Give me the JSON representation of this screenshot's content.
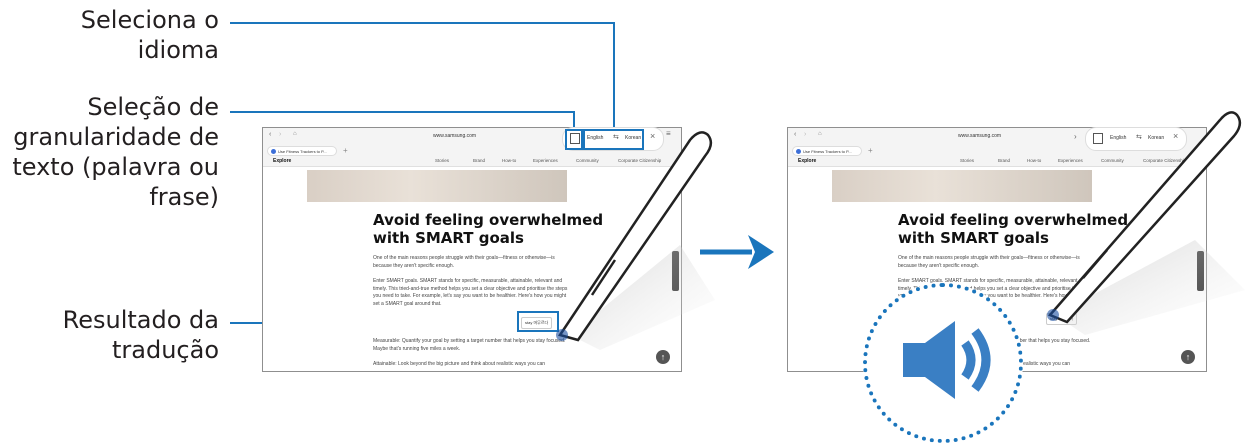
{
  "callouts": {
    "language": "Seleciona o\nidioma",
    "granularity": "Seleção de\ngranularidade de\ntexto (palavra ou\nfrase)",
    "result": "Resultado da\ntradução"
  },
  "browser": {
    "url": "www.samsung.com",
    "tab_title": "Use Fitness Trackers to P...",
    "brand": "Explore",
    "nav_items": [
      "Stories",
      "Brand",
      "How-to",
      "Experiences",
      "Community",
      "Corporate Citizenship"
    ]
  },
  "article": {
    "headline_line1": "Avoid feeling overwhelmed",
    "headline_line2": "with SMART goals",
    "para1": "One of the main reasons people struggle with their goals—fitness or otherwise—is because they aren't specific enough.",
    "para2": "Enter SMART goals. SMART stands for specific, measurable, attainable, relevant and timely. This tried-and-true method helps you set a clear objective and prioritise the steps you need to take. For example, let's say you want to be healthier. Here's how you might set a SMART goal around that.",
    "para3": "Measurable: Quantify your goal by setting a target number that helps you stay focused. Maybe that's running five miles a week.",
    "para4": "Attainable: Look beyond the big picture and think about realistic ways you can"
  },
  "translate_bar": {
    "source_lang": "English",
    "target_lang": "Korean",
    "swap_icon": "swap-icon",
    "text_mode_icon": "text-granularity-icon",
    "close_icon": "close-icon"
  },
  "translation_popup": {
    "source_word": "stay",
    "translated": "머무르다"
  },
  "colors": {
    "accent": "#1a75bc",
    "text": "#231f20"
  }
}
